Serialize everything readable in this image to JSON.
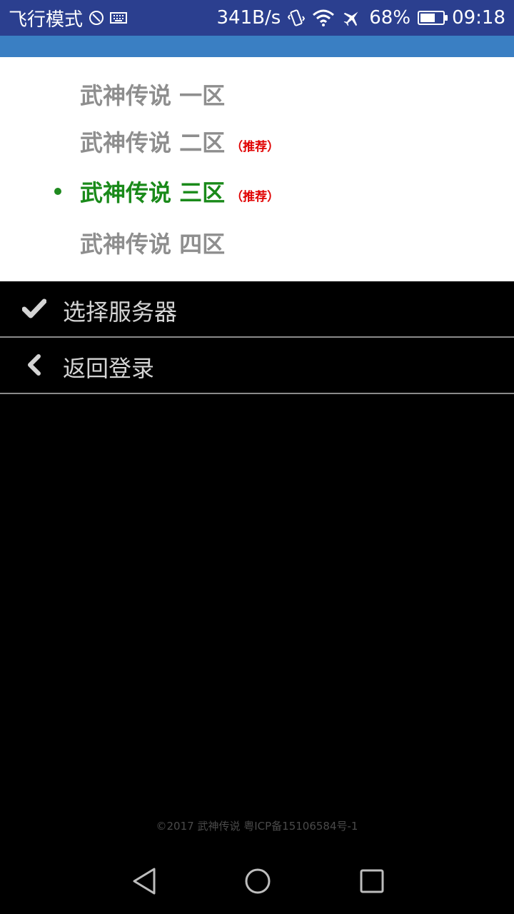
{
  "status_bar": {
    "mode": "飞行模式",
    "speed": "341B/s",
    "battery_pct": "68%",
    "battery_level": 0.68,
    "time": "09:18",
    "icons": [
      "no-sync-icon",
      "keyboard-icon",
      "vibrate-icon",
      "wifi-icon",
      "airplane-icon",
      "battery-icon"
    ]
  },
  "servers": [
    {
      "name": "武神传说  一区",
      "recommend": "",
      "selected": false
    },
    {
      "name": "武神传说  二区",
      "recommend": "（推荐）",
      "selected": false
    },
    {
      "name": "武神传说  三区",
      "recommend": "（推荐）",
      "selected": true
    },
    {
      "name": "武神传说  四区",
      "recommend": "",
      "selected": false
    }
  ],
  "menu": {
    "select_server": "选择服务器",
    "back_login": "返回登录"
  },
  "footer": "©2017 武神传说 粤ICP备15106584号-1",
  "colors": {
    "status_bg": "#2b3f8f",
    "header_bg": "#3a7fc3",
    "selected_green": "#1a8a1a",
    "recommend_red": "#e00000",
    "unselected_gray": "#8e8e8e"
  }
}
